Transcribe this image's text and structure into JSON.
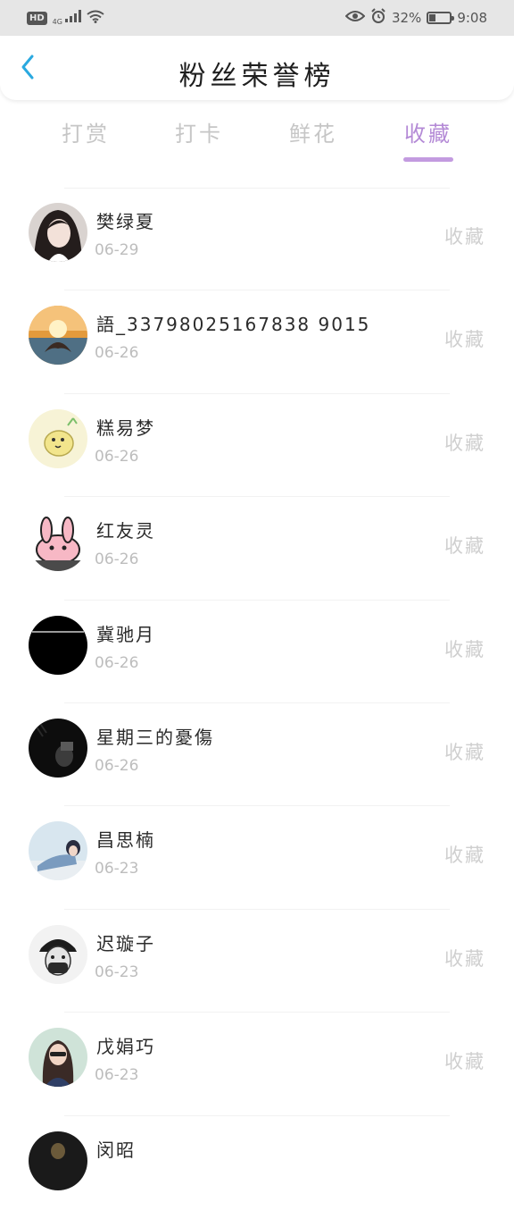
{
  "status_bar": {
    "hd": "HD",
    "network": "4G",
    "battery_percent": "32%",
    "battery_level": 0.32,
    "time": "9:08",
    "icons": [
      "signal-icon",
      "wifi-icon",
      "eye-icon",
      "alarm-icon",
      "battery-icon"
    ]
  },
  "header": {
    "title": "粉丝荣誉榜",
    "back_icon": "chevron-left-icon"
  },
  "tabs": [
    {
      "label": "打赏",
      "active": false
    },
    {
      "label": "打卡",
      "active": false
    },
    {
      "label": "鲜花",
      "active": false
    },
    {
      "label": "收藏",
      "active": true
    }
  ],
  "fans": [
    {
      "name": "樊绿夏",
      "date": "06-29",
      "action": "收藏"
    },
    {
      "name": "語_33798025167838 9015",
      "date": "06-26",
      "action": "收藏"
    },
    {
      "name": "糕易梦",
      "date": "06-26",
      "action": "收藏"
    },
    {
      "name": "红友灵",
      "date": "06-26",
      "action": "收藏"
    },
    {
      "name": "冀驰月",
      "date": "06-26",
      "action": "收藏"
    },
    {
      "name": "星期三的憂傷",
      "date": "06-26",
      "action": "收藏"
    },
    {
      "name": "昌思楠",
      "date": "06-23",
      "action": "收藏"
    },
    {
      "name": "迟璇子",
      "date": "06-23",
      "action": "收藏"
    },
    {
      "name": "戊娟巧",
      "date": "06-23",
      "action": "收藏"
    },
    {
      "name": "闵昭",
      "date": "",
      "action": ""
    }
  ],
  "colors": {
    "accent": "#b48ad6",
    "tab_inactive": "#c6c6c6",
    "status_bar_bg": "#e6e6e6",
    "back_arrow": "#2aa9e0"
  }
}
